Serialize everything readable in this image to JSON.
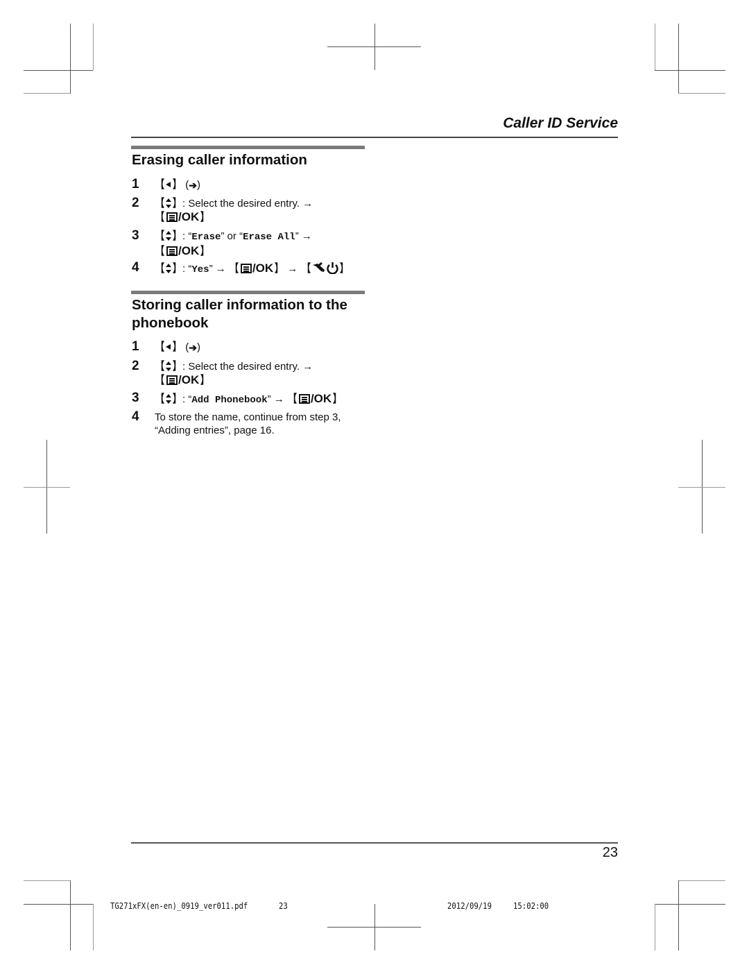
{
  "running_head": "Caller ID Service",
  "sections": [
    {
      "title": "Erasing caller information",
      "steps": [
        {
          "num": "1",
          "parts": {
            "incoming_label": "(",
            "incoming_close": ")"
          }
        },
        {
          "num": "2",
          "text": ": Select the desired entry.",
          "arrow": "→",
          "ok": "/OK"
        },
        {
          "num": "3",
          "sep": ": ",
          "q1": "“",
          "opt1": "Erase",
          "q1c": "”",
          "or": " or ",
          "q2": "“",
          "opt2": "Erase All",
          "q2c": "”",
          "arrow": "→",
          "ok": "/OK"
        },
        {
          "num": "4",
          "sep": ": ",
          "q": "“",
          "opt": "Yes",
          "qc": "”",
          "arrow": "→",
          "ok": "/OK",
          "arrow2": "→"
        }
      ]
    },
    {
      "title_line1": "Storing caller information to the",
      "title_line2": "phonebook",
      "steps": [
        {
          "num": "1",
          "parts": {
            "incoming_label": "(",
            "incoming_close": ")"
          }
        },
        {
          "num": "2",
          "text": ": Select the desired entry.",
          "arrow": "→",
          "ok": "/OK"
        },
        {
          "num": "3",
          "sep": ": ",
          "q": "“",
          "opt": "Add Phonebook",
          "qc": "”",
          "arrow": "→",
          "ok": "/OK"
        },
        {
          "num": "4",
          "line1": "To store the name, continue from step 3,",
          "line2": "“Adding entries”, page 16."
        }
      ]
    }
  ],
  "icons": {
    "left_key": "left-arrow-icon",
    "incoming": "incoming-call-icon",
    "navigator": "up-down-icon",
    "menu": "menu-icon",
    "off_power": "off-power-icon"
  },
  "brackets": {
    "open": "【",
    "close": "】"
  },
  "page_number": "23",
  "slug": {
    "file": "TG271xFX(en-en)_0919_ver011.pdf",
    "page": "23",
    "date": "2012/09/19",
    "time": "15:02:00"
  }
}
